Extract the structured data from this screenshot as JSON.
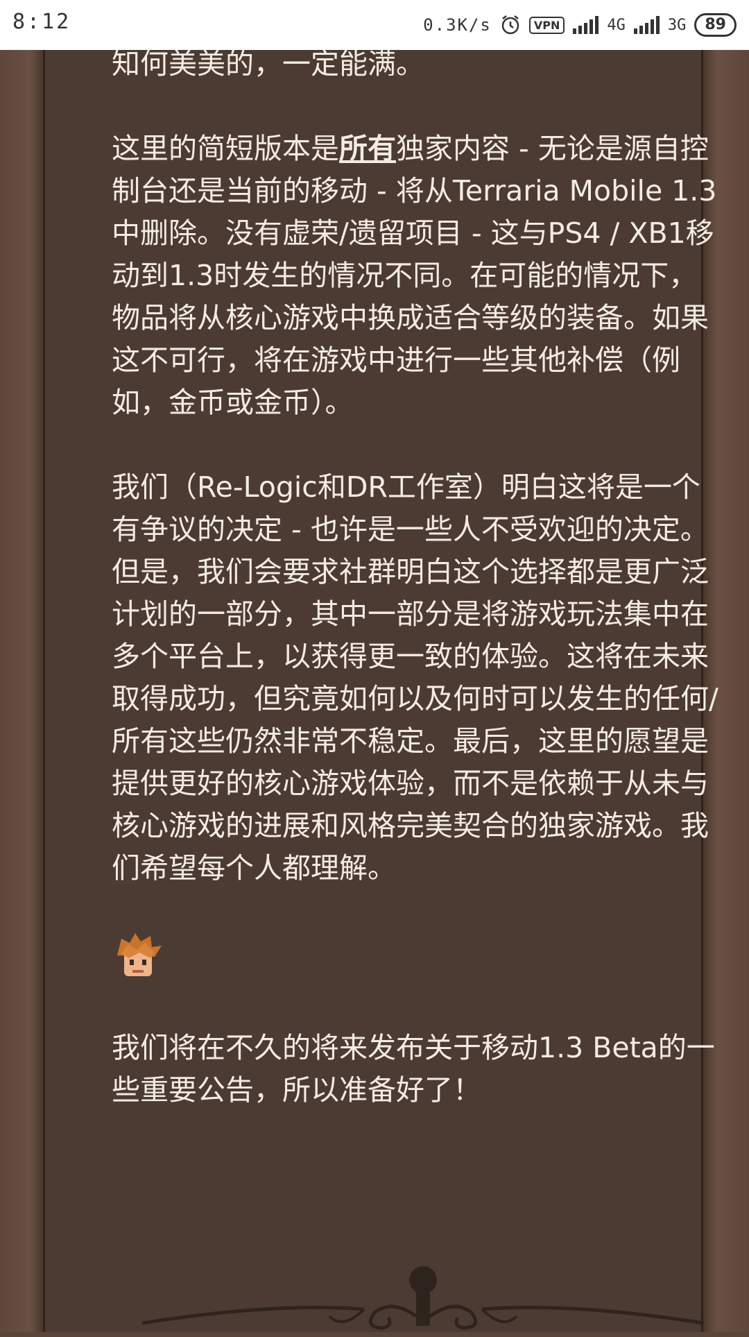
{
  "status_bar": {
    "time": "8:12",
    "net_speed": "0.3K/s",
    "vpn_label": "VPN",
    "net1": "4G",
    "net2": "3G",
    "battery": "89"
  },
  "article": {
    "partial_line": "知何美美的，一定能满。",
    "p1_before": "这里的简短版本是",
    "p1_highlight": "所有",
    "p1_after": "独家内容 - 无论是源自控制台还是当前的移动 - 将从Terraria Mobile 1.3中删除。没有虚荣/遗留项目 - 这与PS4 / XB1移动到1.3时发生的情况不同。在可能的情况下，物品将从核心游戏中换成适合等级的装备。如果这不可行，将在游戏中进行一些其他补偿（例如，金币或金币）。",
    "p2": "我们（Re-Logic和DR工作室）明白这将是一个有争议的决定 - 也许是一些人不受欢迎的决定。但是，我们会要求社群明白这个选择都是更广泛计划的一部分，其中一部分是将游戏玩法集中在多个平台上，以获得更一致的体验。这将在未来取得成功，但究竟如何以及何时可以发生的任何/所有这些仍然非常不稳定。最后，这里的愿望是提供更好的核心游戏体验，而不是依赖于从未与核心游戏的进展和风格完美契合的独家游戏。我们希望每个人都理解。",
    "p3": "我们将在不久的将来发布关于移动1.3 Beta的一些重要公告，所以准备好了！"
  },
  "colors": {
    "panel_bg": "#4c3b33",
    "text": "#f3ece4",
    "rail": "#6a5043"
  },
  "icons": {
    "avatar": "guide-face-emoji",
    "ornament": "scroll-flourish-divider"
  }
}
